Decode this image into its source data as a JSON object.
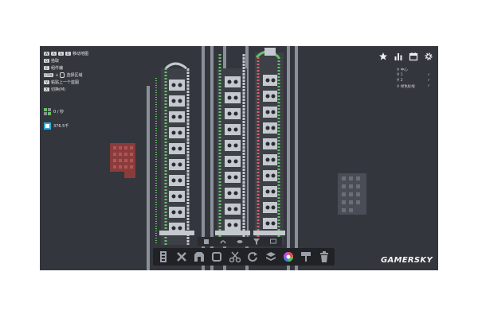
{
  "hints": [
    {
      "keys": [
        "W",
        "A",
        "S",
        "D"
      ],
      "label": "移动地图"
    },
    {
      "keys": [
        "Q"
      ],
      "label": "拾取"
    },
    {
      "keys": [
        "E"
      ],
      "label": "组件编"
    },
    {
      "keys": [
        "CTRL",
        "+"
      ],
      "label": "选择区域"
    },
    {
      "keys": [
        "V"
      ],
      "label": "粘贴上一个蓝图"
    },
    {
      "keys": [
        "X"
      ],
      "label": "切换(M)"
    }
  ],
  "stats": {
    "rate": "0 / 秒",
    "count": "376.5千"
  },
  "top_icons": [
    "star-icon",
    "stats-icon",
    "calendar-icon",
    "gear-icon"
  ],
  "layers": [
    {
      "label": "中心",
      "state": ""
    },
    {
      "label": "1",
      "state": "✓"
    },
    {
      "label": "2",
      "state": "✓"
    },
    {
      "label": "绿色标线",
      "state": "✓"
    }
  ],
  "toolbar_tools": [
    "belt-tool",
    "splitter-tool",
    "cutter-tool",
    "rotator-tool",
    "stacker-tool",
    "mixer-tool",
    "painter-tool",
    "trash-tool"
  ],
  "colors": {
    "background": "#33363d",
    "belt": "#8a8f98",
    "building": "#c4c8cf",
    "wire_green": "#6cc06c",
    "wire_red": "#d86060",
    "highlight": "#2ea8e0"
  },
  "watermark": "GAMERSKY"
}
